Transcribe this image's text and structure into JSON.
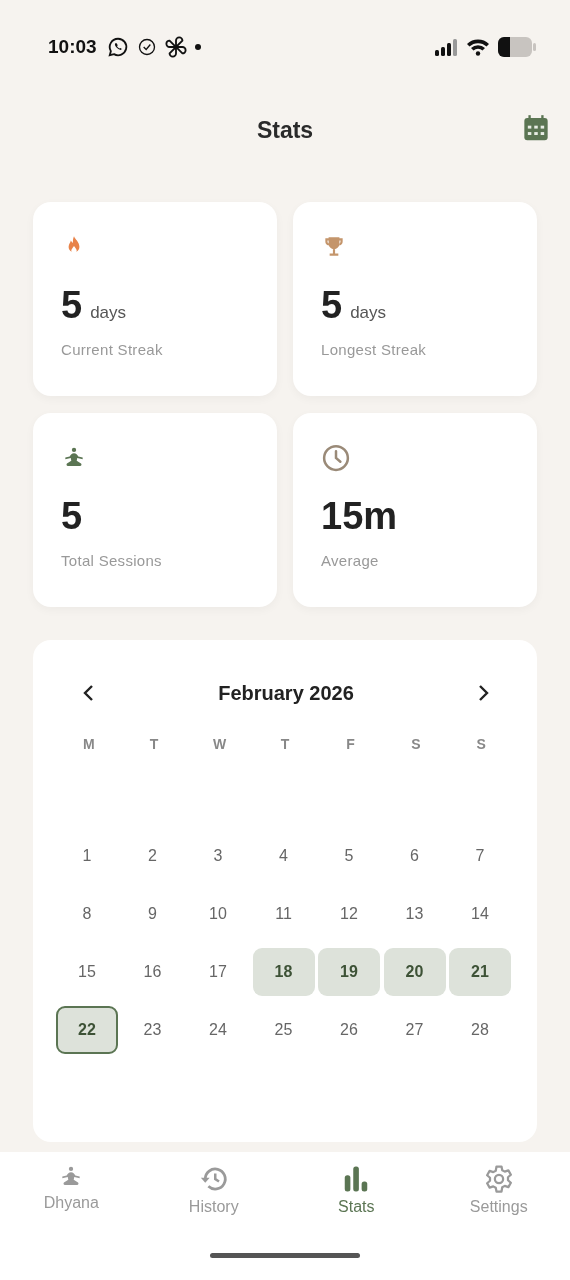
{
  "status_bar": {
    "time": "10:03"
  },
  "header": {
    "title": "Stats"
  },
  "stat_cards": [
    {
      "kind": "flame",
      "value": "5",
      "unit": "days",
      "label": "Current Streak"
    },
    {
      "kind": "trophy",
      "value": "5",
      "unit": "days",
      "label": "Longest Streak"
    },
    {
      "kind": "meditation",
      "value": "5",
      "label": "Total Sessions"
    },
    {
      "kind": "clock",
      "value": "15m",
      "label": "Average"
    }
  ],
  "calendar": {
    "month": "February 2026",
    "weekdays": [
      "M",
      "T",
      "W",
      "T",
      "F",
      "S",
      "S"
    ],
    "days": [
      {
        "day": "1",
        "streak": false,
        "today": false
      },
      {
        "day": "2",
        "streak": false,
        "today": false
      },
      {
        "day": "3",
        "streak": false,
        "today": false
      },
      {
        "day": "4",
        "streak": false,
        "today": false
      },
      {
        "day": "5",
        "streak": false,
        "today": false
      },
      {
        "day": "6",
        "streak": false,
        "today": false
      },
      {
        "day": "7",
        "streak": false,
        "today": false
      },
      {
        "day": "8",
        "streak": false,
        "today": false
      },
      {
        "day": "9",
        "streak": false,
        "today": false
      },
      {
        "day": "10",
        "streak": false,
        "today": false
      },
      {
        "day": "11",
        "streak": false,
        "today": false
      },
      {
        "day": "12",
        "streak": false,
        "today": false
      },
      {
        "day": "13",
        "streak": false,
        "today": false
      },
      {
        "day": "14",
        "streak": false,
        "today": false
      },
      {
        "day": "15",
        "streak": false,
        "today": false
      },
      {
        "day": "16",
        "streak": false,
        "today": false
      },
      {
        "day": "17",
        "streak": false,
        "today": false
      },
      {
        "day": "18",
        "streak": true,
        "today": false
      },
      {
        "day": "19",
        "streak": true,
        "today": false
      },
      {
        "day": "20",
        "streak": true,
        "today": false
      },
      {
        "day": "21",
        "streak": true,
        "today": false
      },
      {
        "day": "22",
        "streak": true,
        "today": true
      },
      {
        "day": "23",
        "streak": false,
        "today": false
      },
      {
        "day": "24",
        "streak": false,
        "today": false
      },
      {
        "day": "25",
        "streak": false,
        "today": false
      },
      {
        "day": "26",
        "streak": false,
        "today": false
      },
      {
        "day": "27",
        "streak": false,
        "today": false
      },
      {
        "day": "28",
        "streak": false,
        "today": false
      }
    ]
  },
  "nav": [
    {
      "kind": "meditation",
      "label": "Dhyana",
      "selected": false
    },
    {
      "kind": "history",
      "label": "History",
      "selected": false
    },
    {
      "kind": "stats",
      "label": "Stats",
      "selected": true
    },
    {
      "kind": "settings",
      "label": "Settings",
      "selected": false
    }
  ]
}
